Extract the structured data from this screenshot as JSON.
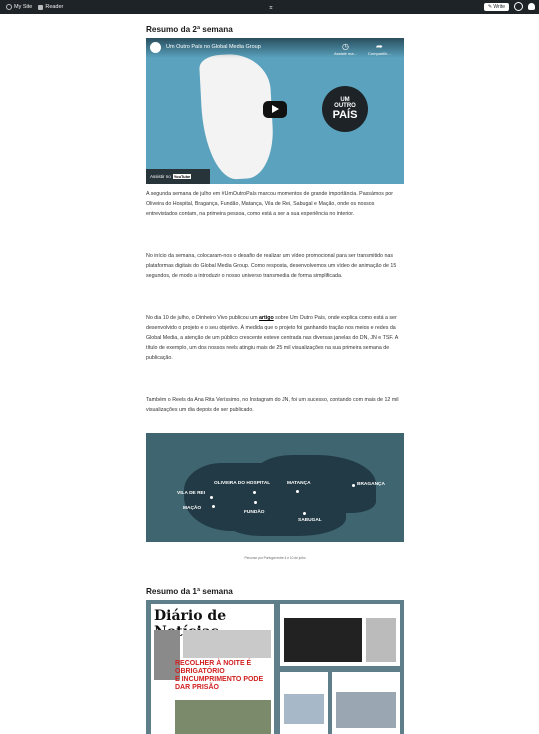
{
  "adminbar": {
    "my_site": "My Site",
    "reader": "Reader",
    "write": "Write"
  },
  "week2": {
    "heading": "Resumo da 2ª semana",
    "video": {
      "title": "Um Outro País no Global Media Group",
      "watch_later": "Assistir ma...",
      "share": "Compartilh...",
      "badge_line1": "UM",
      "badge_line2": "OUTRO",
      "badge_line3": "PAÍS",
      "watch_on": "Assistir no",
      "youtube": "YouTube"
    },
    "paragraphs": {
      "p1": "A segunda semana de julho em #UmOutroPaís marcou momentos de grande importância. Passámos por Oliveira do Hospital, Bragança, Fundão, Matança, Vila de Rei, Sabugal e Mação, onde os nossos entrevistados contam, na primeira pessoa, como está a ser a sua experiência no interior.",
      "p2": "No início da semana, colocaram-nos o desafio de realizar um vídeo promocional para ser transmitido nas plataformas digitais do Global Media Group. Como resposta, desenvolvemos um vídeo de animação de 15 segundos, de modo a introduzir o nosso universo transmedia de forma simplificada.",
      "p3_before": "No dia 10 de julho, o Dinheiro Vivo publicou um ",
      "p3_link": "artigo",
      "p3_after": " sobre Um Outro País, onde explica como está a ser desenvolvido o projeto e o seu objetivo. À medida que o projeto foi ganhando tração nos meios e redes da Global Media, a atenção de um público crescente esteve centrada nas diversas janelas do DN, JN e TSF. A título de exemplo, um dos nossos reels atingiu mais de 25 mil visualizações na sua primeira semana de publicação.",
      "p4": "Também o Reels da Ana Rita Veríssimo, no Instagram do JN, foi um sucesso, contando com mais de 12 mil visualizações um dia depois de ser publicado."
    },
    "map": {
      "labels": [
        "OLIVEIRA DO HOSPITAL",
        "MATANÇA",
        "BRAGANÇA",
        "VILA DE REI",
        "MAÇÃO",
        "FUNDÃO",
        "SABUGAL"
      ],
      "caption": "Percurso por Portugal entre 4 e 10 de julho"
    }
  },
  "week1": {
    "heading": "Resumo da 1ª semana",
    "newspaper_title": "Diário de Notícias",
    "headline_line1": "RECOLHER À NOITE É OBRIGATÓRIO",
    "headline_line2": "E INCUMPRIMENTO PODE DAR PRISÃO"
  }
}
